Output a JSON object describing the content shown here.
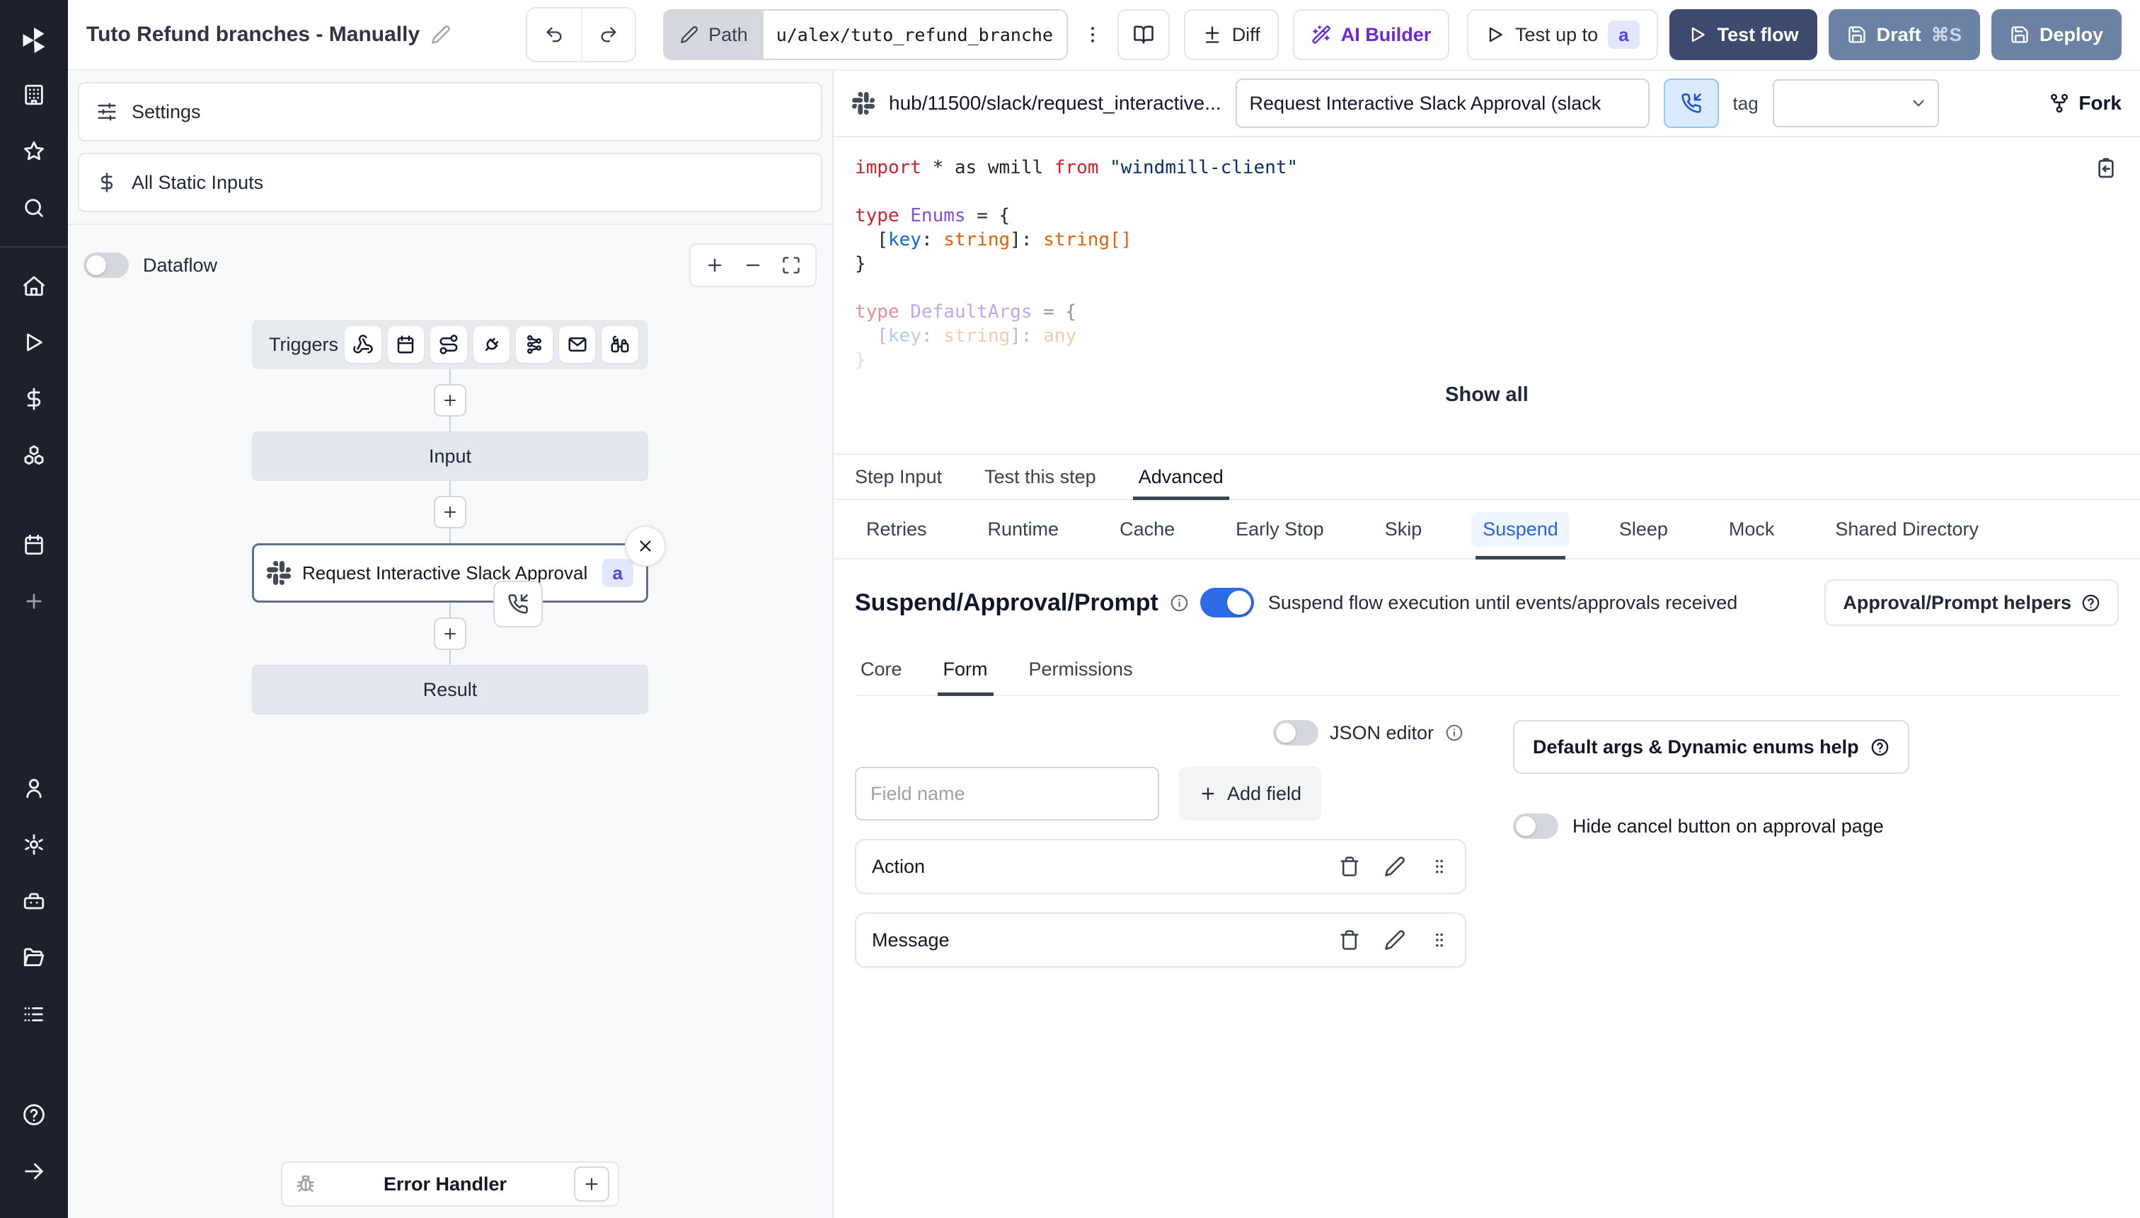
{
  "colors": {
    "accent_blue": "#2e6be6",
    "suspend_tab_blue": "#2563eb",
    "indigo_badge": "#4f46e5",
    "dark_navy_button": "#3e4a6d",
    "slate_button": "#6b82a4",
    "ai_purple": "#6d28d9",
    "sidebar_dark": "#1c212b"
  },
  "header": {
    "title": "Tuto Refund branches - Manually",
    "path_label": "Path",
    "path_value": "u/alex/tuto_refund_branches_",
    "diff_label": "Diff",
    "ai_builder_label": "AI Builder",
    "test_up_to_label": "Test up to",
    "test_up_to_badge": "a",
    "test_flow_label": "Test flow",
    "draft_label": "Draft",
    "draft_shortcut": "⌘S",
    "deploy_label": "Deploy"
  },
  "sidebar": {
    "icons": [
      "windmill-logo",
      "workspace",
      "favorites",
      "search",
      "home",
      "runs",
      "variables",
      "resources",
      "schedules",
      "create",
      "account",
      "settings",
      "workers",
      "folders",
      "audit-logs",
      "help",
      "collapse"
    ]
  },
  "flow": {
    "settings_label": "Settings",
    "static_inputs_label": "All Static Inputs",
    "dataflow_label": "Dataflow",
    "triggers_label": "Triggers",
    "trigger_icons": [
      "webhook",
      "schedule",
      "http-route",
      "websocket",
      "kafka",
      "email",
      "poll"
    ],
    "input_label": "Input",
    "step_label": "Request Interactive Slack Approval (...",
    "step_badge": "a",
    "result_label": "Result",
    "error_handler_label": "Error Handler"
  },
  "detail": {
    "hub_path": "hub/11500/slack/request_interactive...",
    "summary": "Request Interactive Slack Approval (slack",
    "tag_label": "tag",
    "fork_label": "Fork",
    "show_all": "Show all",
    "tabs": [
      {
        "label": "Step Input"
      },
      {
        "label": "Test this step"
      },
      {
        "label": "Advanced"
      }
    ],
    "subtabs": [
      {
        "label": "Retries"
      },
      {
        "label": "Runtime"
      },
      {
        "label": "Cache"
      },
      {
        "label": "Early Stop"
      },
      {
        "label": "Skip"
      },
      {
        "label": "Suspend"
      },
      {
        "label": "Sleep"
      },
      {
        "label": "Mock"
      },
      {
        "label": "Shared Directory"
      }
    ],
    "code": {
      "lines": [
        {
          "tokens": [
            [
              "import",
              "kw"
            ],
            [
              " ",
              "pl"
            ],
            [
              "*",
              "pl"
            ],
            [
              " ",
              "pl"
            ],
            [
              "as",
              "pl"
            ],
            [
              " wmill ",
              "pl"
            ],
            [
              "from",
              "kw"
            ],
            [
              " ",
              "pl"
            ],
            [
              "\"windmill-client\"",
              "str"
            ]
          ]
        },
        {
          "tokens": []
        },
        {
          "tokens": [
            [
              "type",
              "kw"
            ],
            [
              " ",
              "pl"
            ],
            [
              "Enums",
              "type"
            ],
            [
              " = {",
              "pl"
            ]
          ]
        },
        {
          "tokens": [
            [
              "  [",
              "pl"
            ],
            [
              "key",
              "prop"
            ],
            [
              ": ",
              "pl"
            ],
            [
              "string",
              "orange"
            ],
            [
              "]: ",
              "pl"
            ],
            [
              "string[]",
              "orange"
            ]
          ]
        },
        {
          "tokens": [
            [
              "}",
              "pl"
            ]
          ]
        },
        {
          "tokens": []
        },
        {
          "opacity": 0.5,
          "tokens": [
            [
              "type",
              "kw"
            ],
            [
              " ",
              "pl"
            ],
            [
              "DefaultArgs",
              "type"
            ],
            [
              " = {",
              "pl"
            ]
          ]
        },
        {
          "opacity": 0.32,
          "tokens": [
            [
              "  [",
              "pl"
            ],
            [
              "key",
              "prop"
            ],
            [
              ": ",
              "pl"
            ],
            [
              "string",
              "orange"
            ],
            [
              "]: ",
              "pl"
            ],
            [
              "any",
              "orange"
            ]
          ]
        },
        {
          "opacity": 0.15,
          "tokens": [
            [
              "}",
              "pl"
            ]
          ]
        }
      ]
    },
    "suspend": {
      "heading": "Suspend/Approval/Prompt",
      "caption": "Suspend flow execution until events/approvals received",
      "helpers_label": "Approval/Prompt helpers",
      "tabs": [
        {
          "label": "Core"
        },
        {
          "label": "Form"
        },
        {
          "label": "Permissions"
        }
      ],
      "json_editor_label": "JSON editor",
      "field_name_placeholder": "Field name",
      "add_field_label": "Add field",
      "fields": [
        {
          "label": "Action"
        },
        {
          "label": "Message"
        }
      ],
      "default_args_help_label": "Default args & Dynamic enums help",
      "hide_cancel_label": "Hide cancel button on approval page"
    }
  }
}
